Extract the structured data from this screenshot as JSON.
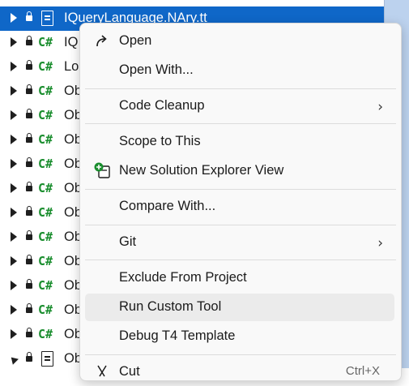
{
  "tree": {
    "rows": [
      {
        "label": "IQueryLanguage.NAry.tt",
        "type": "doc",
        "selected": true
      },
      {
        "label": "IQ",
        "type": "cs"
      },
      {
        "label": "Lo",
        "type": "cs"
      },
      {
        "label": "Ob",
        "type": "cs"
      },
      {
        "label": "Ob",
        "type": "cs"
      },
      {
        "label": "Ob",
        "type": "cs"
      },
      {
        "label": "Ob",
        "type": "cs"
      },
      {
        "label": "Ob",
        "type": "cs"
      },
      {
        "label": "Ob",
        "type": "cs"
      },
      {
        "label": "Ob",
        "type": "cs"
      },
      {
        "label": "Ob",
        "type": "cs"
      },
      {
        "label": "Ob",
        "type": "cs"
      },
      {
        "label": "Ob",
        "type": "cs"
      },
      {
        "label": "Ob",
        "type": "cs"
      },
      {
        "label": "Ob",
        "type": "doc",
        "expanded": true
      }
    ],
    "cs_glyph": "C#"
  },
  "menu": {
    "items": [
      {
        "label": "Open",
        "icon": "open-arrow-icon"
      },
      {
        "label": "Open With..."
      },
      {
        "label": "Code Cleanup",
        "submenu": true
      },
      {
        "label": "Scope to This"
      },
      {
        "label": "New Solution Explorer View",
        "icon": "new-solution-explorer-icon"
      },
      {
        "label": "Compare With..."
      },
      {
        "label": "Git",
        "submenu": true
      },
      {
        "label": "Exclude From Project"
      },
      {
        "label": "Run Custom Tool",
        "hover": true
      },
      {
        "label": "Debug T4 Template"
      },
      {
        "label": "Cut",
        "shortcut": "Ctrl+X",
        "icon": "cut-icon"
      }
    ],
    "chevron": "›"
  },
  "colors": {
    "selection": "#0f67c8",
    "csharp": "#1b8e2f",
    "menu_bg": "#f9f9f9",
    "hover_bg": "#ebebeb",
    "right_panel": "#bcd2ee"
  }
}
